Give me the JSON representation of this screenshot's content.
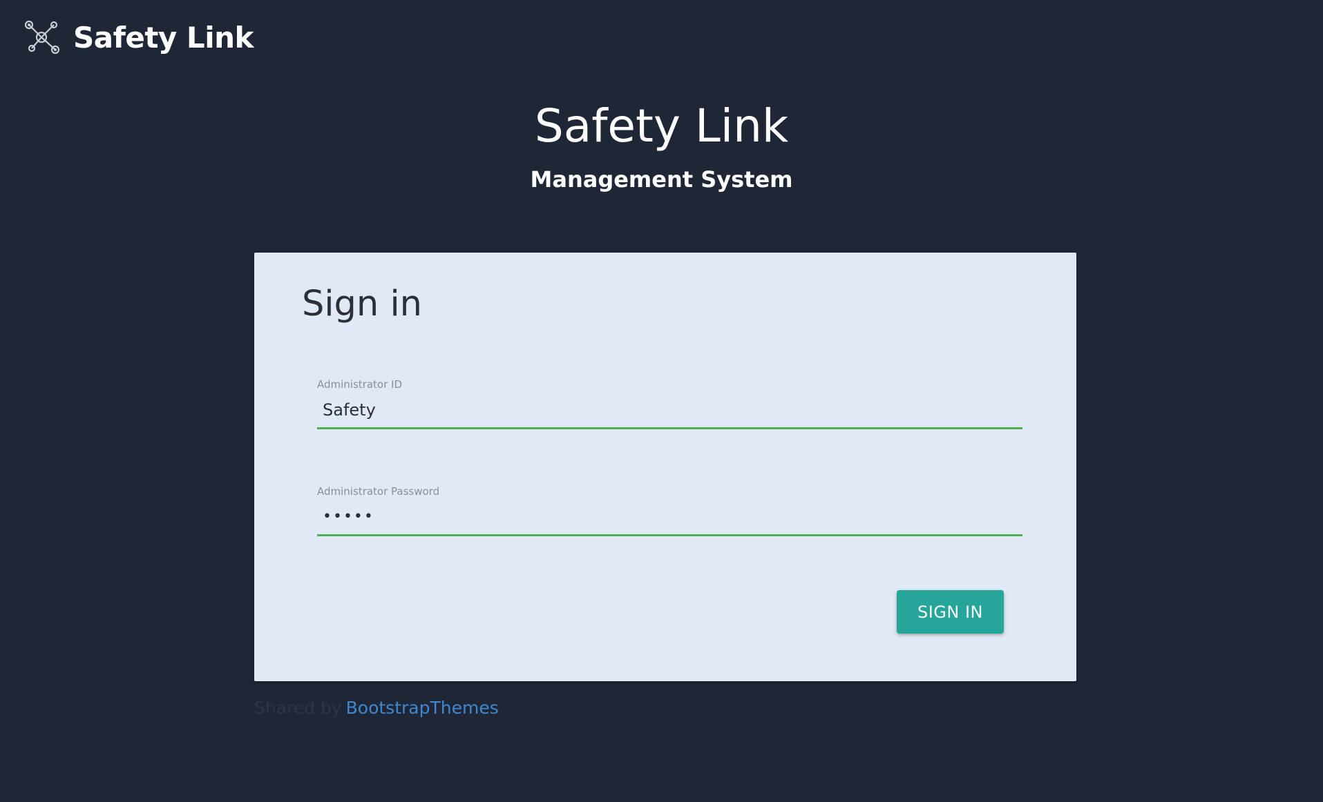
{
  "brand": {
    "name": "Safety Link",
    "icon": "network-nodes-icon"
  },
  "hero": {
    "title": "Safety Link",
    "subtitle": "Management System"
  },
  "signin": {
    "title": "Sign in",
    "admin_id": {
      "label": "Administrator ID",
      "value": "Safety"
    },
    "admin_password": {
      "label": "Administrator Password",
      "value": "•••••"
    },
    "button_label": "SIGN IN"
  },
  "footer": {
    "prefix": "Shared by",
    "link_text": "BootstrapThemes"
  },
  "colors": {
    "page_background": "#1f2737",
    "card_background": "#e0e9f5",
    "input_underline": "#4caf50",
    "button_background": "#26a69a",
    "link": "#3f88d0"
  }
}
